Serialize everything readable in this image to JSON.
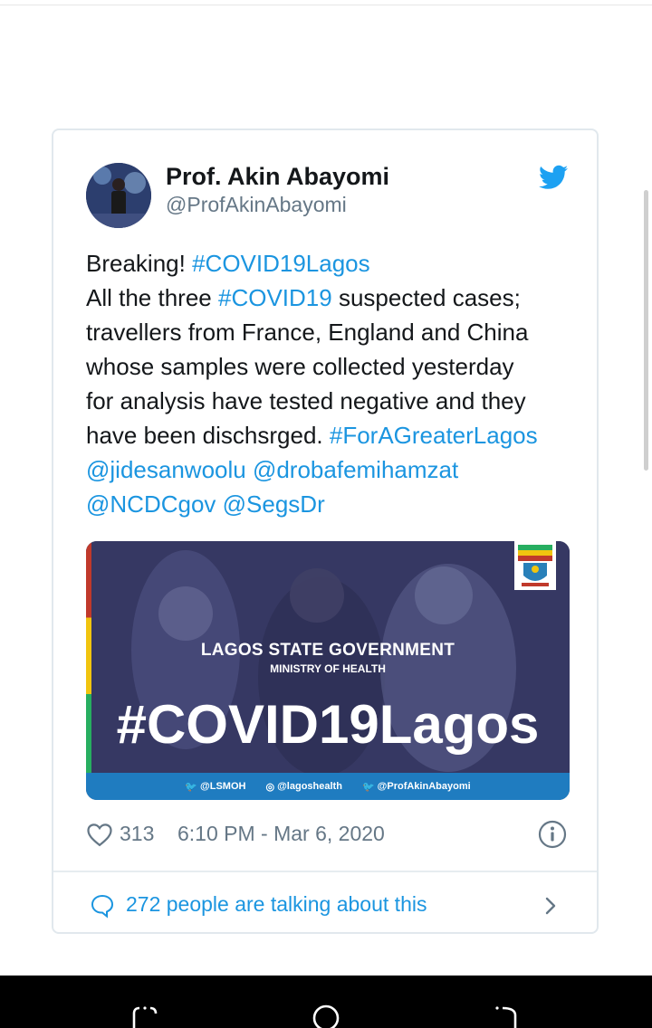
{
  "tweet": {
    "author_name": "Prof. Akin Abayomi",
    "author_handle": "@ProfAkinAbayomi",
    "text_lines": [
      [
        {
          "t": "Breaking! ",
          "link": false
        },
        {
          "t": "#COVID19Lagos",
          "link": true
        }
      ],
      [
        {
          "t": "All the three ",
          "link": false
        },
        {
          "t": "#COVID19",
          "link": true
        },
        {
          "t": " suspected cases;",
          "link": false
        }
      ],
      [
        {
          "t": "travellers from France, England and  China",
          "link": false
        }
      ],
      [
        {
          "t": "whose samples were collected yesterday",
          "link": false
        }
      ],
      [
        {
          "t": "for analysis have tested negative and they",
          "link": false
        }
      ],
      [
        {
          "t": "have been dischsrged. ",
          "link": false
        },
        {
          "t": "#ForAGreaterLagos",
          "link": true
        }
      ],
      [
        {
          "t": "@jidesanwoolu",
          "link": true
        },
        {
          "t": " ",
          "link": false
        },
        {
          "t": "@drobafemihamzat",
          "link": true
        }
      ],
      [
        {
          "t": "@NCDCgov",
          "link": true
        },
        {
          "t": " ",
          "link": false
        },
        {
          "t": "@SegsDr",
          "link": true
        }
      ]
    ],
    "media": {
      "title": "LAGOS STATE GOVERNMENT",
      "subtitle": "MINISTRY OF HEALTH",
      "hashtag": "#COVID19Lagos",
      "social": [
        "@LSMOH",
        "@lagoshealth",
        "@ProfAkinAbayomi"
      ]
    },
    "likes": "313",
    "timestamp": "6:10 PM - Mar 6, 2020",
    "talking": "272 people are talking about this"
  },
  "colors": {
    "link": "#1b95e0",
    "muted": "#657786",
    "text": "#14171a",
    "border": "#e1e8ed"
  },
  "icons": [
    "twitter-bird-icon",
    "heart-icon",
    "info-icon",
    "comment-bubble-icon",
    "chevron-right-icon"
  ]
}
